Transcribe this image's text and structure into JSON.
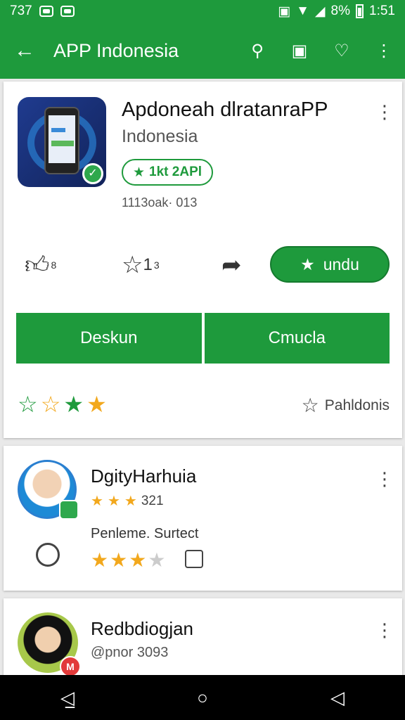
{
  "status_bar": {
    "left_text": "737",
    "battery": "8%",
    "time": "1:51"
  },
  "app_bar": {
    "title": "APP Indonesia"
  },
  "app_card": {
    "name": "Apdoneah dlratanraPP",
    "subtitle": "Indonesia",
    "rating_pill": "1kt 2APl",
    "downloads": "1113oak· 013",
    "like_count": "8",
    "star_count": "1",
    "star_sup": "3",
    "install_button": "undu",
    "button_left": "Deskun",
    "button_right": "Cmucla",
    "pahl_label": "Pahldonis"
  },
  "reviews": [
    {
      "name": "DgityHarhuia",
      "score": "321",
      "text": "Penleme. Surtect",
      "stars_filled": 3,
      "stars_total": 4
    },
    {
      "name": "Redbdiogjan",
      "handle": "@pnor 3093"
    }
  ],
  "icons": {
    "status_left": [
      "message-icon",
      "chat-icon"
    ],
    "status_right": [
      "vibrate-icon",
      "wifi-icon",
      "signal-icon",
      "battery-icon"
    ],
    "app_bar": [
      "back-arrow-icon",
      "search-icon",
      "window-icon",
      "heart-icon",
      "more-vert-icon"
    ],
    "nav": [
      "back-nav-icon",
      "home-nav-icon",
      "recent-nav-icon"
    ]
  },
  "colors": {
    "brand_green": "#1e9a3c",
    "star_yellow": "#f2a81d"
  }
}
